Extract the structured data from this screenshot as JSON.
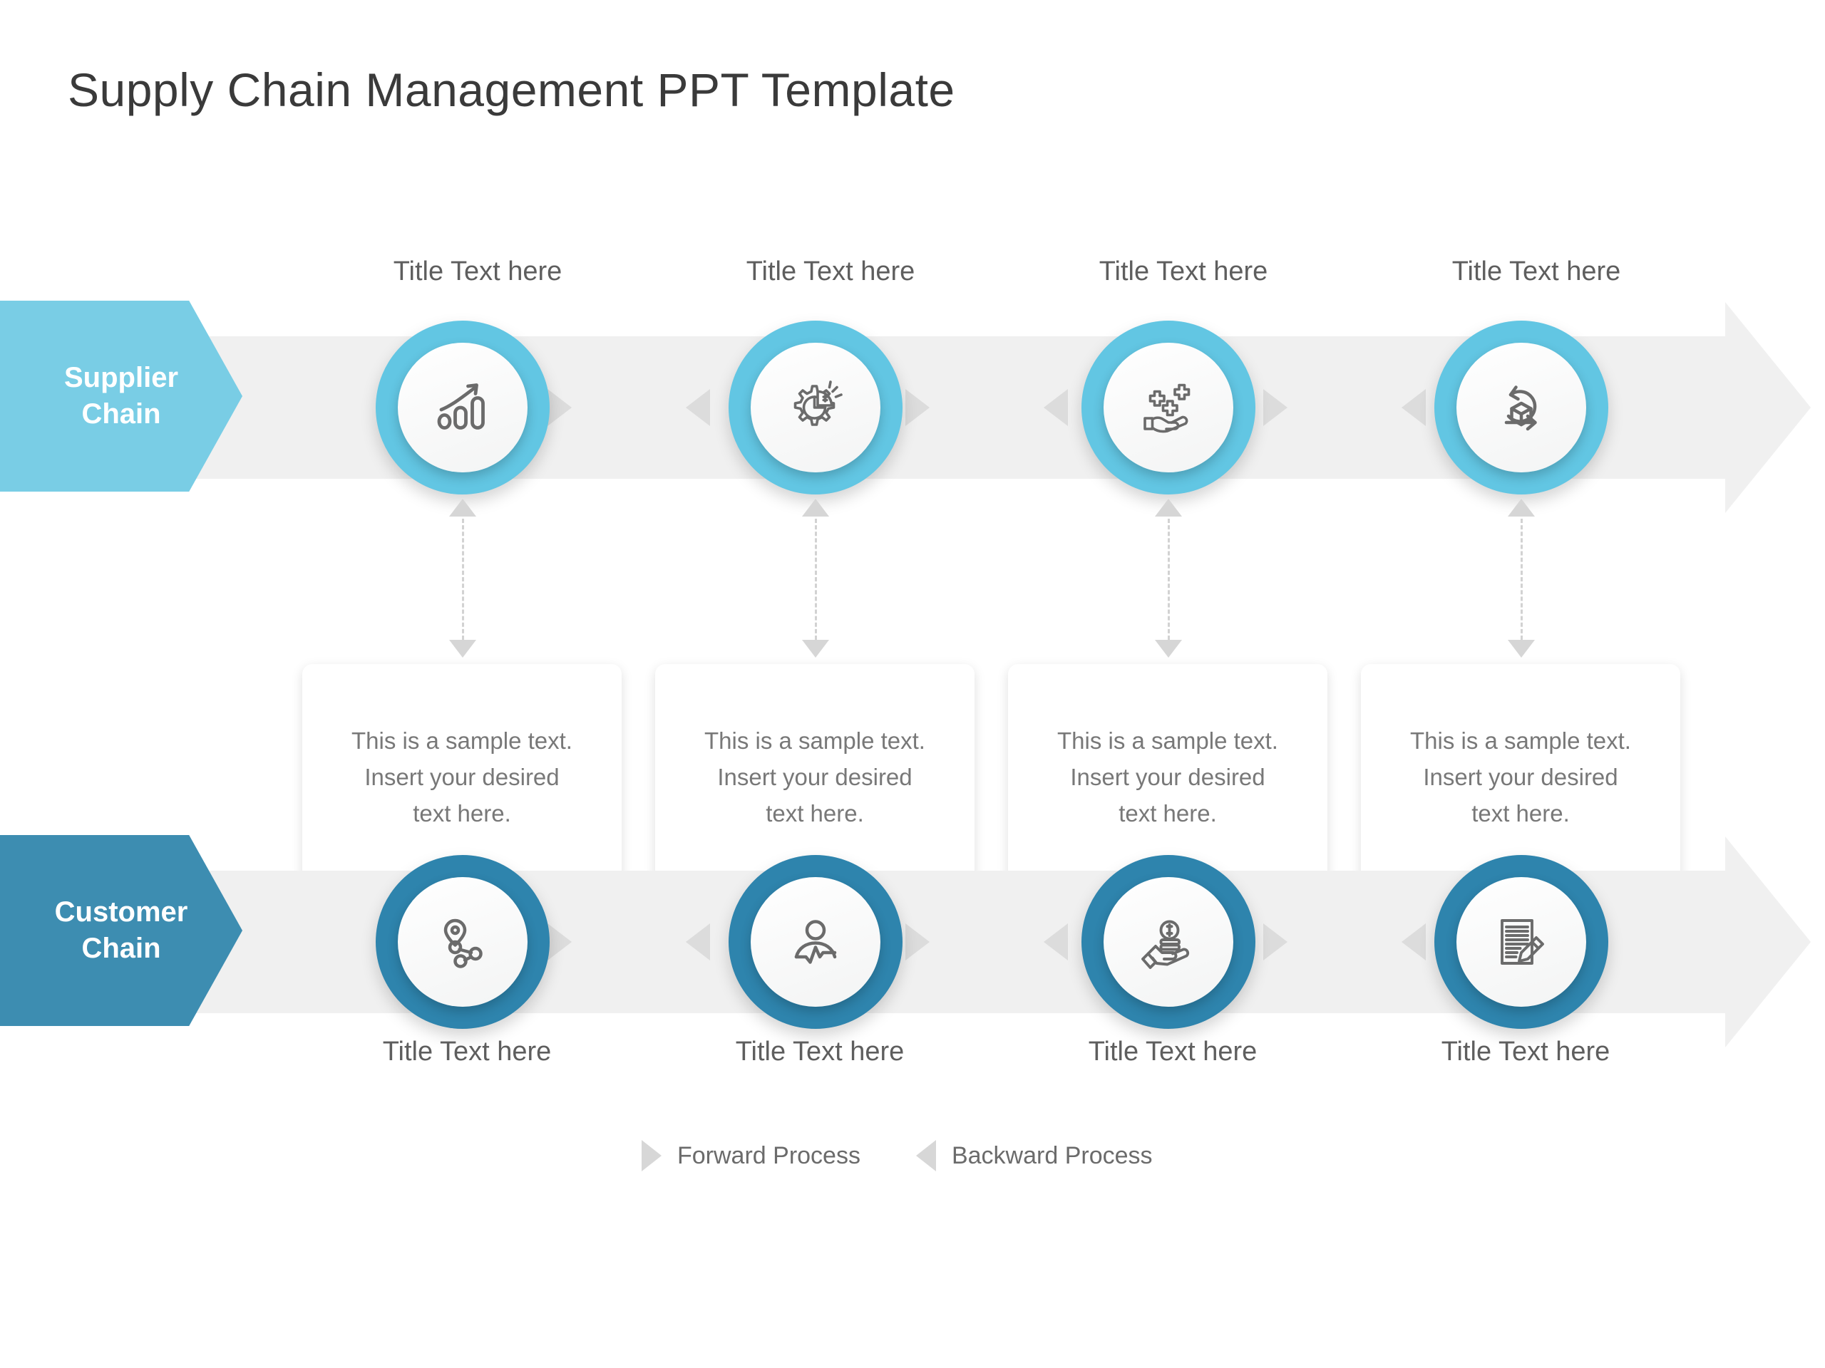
{
  "page_title": "Supply Chain Management PPT Template",
  "rows": {
    "supplier": {
      "label_line1": "Supplier",
      "label_line2": "Chain",
      "color": "#79cde5",
      "node_color": "#62c6e3",
      "nodes": [
        {
          "title": "Title Text here",
          "icon": "growth-chart-icon"
        },
        {
          "title": "Title Text here",
          "icon": "gear-pie-dollar-icon"
        },
        {
          "title": "Title Text here",
          "icon": "hand-benefits-icon"
        },
        {
          "title": "Title Text here",
          "icon": "package-cycle-icon"
        }
      ]
    },
    "customer": {
      "label_line1": "Customer",
      "label_line2": "Chain",
      "color": "#3d8db1",
      "node_color": "#2e84ad",
      "nodes": [
        {
          "title": "Title Text here",
          "icon": "location-network-icon"
        },
        {
          "title": "Title Text here",
          "icon": "person-pulse-icon"
        },
        {
          "title": "Title Text here",
          "icon": "hand-coins-icon"
        },
        {
          "title": "Title Text here",
          "icon": "document-pencil-icon"
        }
      ]
    }
  },
  "cards": [
    {
      "text": "This is a sample text. Insert your desired text here."
    },
    {
      "text": "This is a sample text. Insert your desired text here."
    },
    {
      "text": "This is a sample text. Insert your desired text here."
    },
    {
      "text": "This is a sample text. Insert your desired text here."
    }
  ],
  "legend": {
    "forward_label": "Forward Process",
    "backward_label": "Backward Process",
    "forward_icon": "triangle-right-icon",
    "backward_icon": "triangle-left-icon"
  }
}
